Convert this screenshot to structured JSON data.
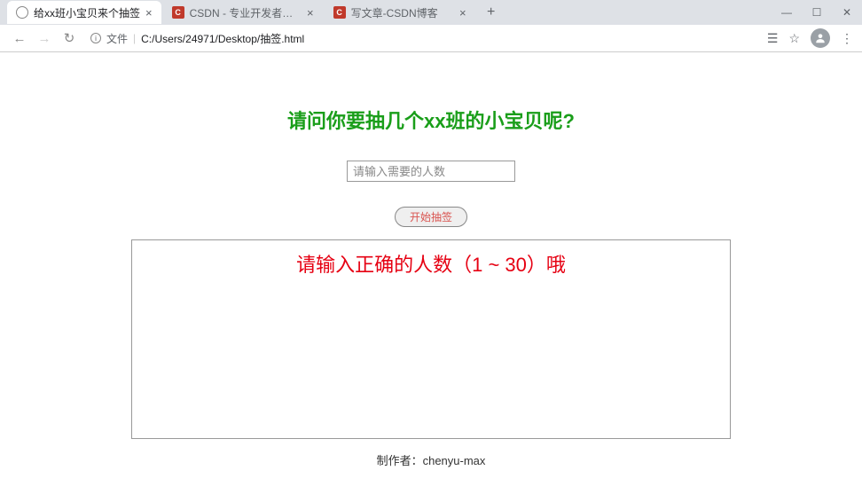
{
  "tabs": [
    {
      "title": "给xx班小宝贝来个抽签",
      "icon": "globe"
    },
    {
      "title": "CSDN - 专业开发者社区",
      "icon": "csdn"
    },
    {
      "title": "写文章-CSDN博客",
      "icon": "csdn"
    }
  ],
  "url": {
    "label": "文件",
    "path": "C:/Users/24971/Desktop/抽签.html"
  },
  "page": {
    "heading": "请问你要抽几个xx班的小宝贝呢?",
    "input_placeholder": "请输入需要的人数",
    "start_button": "开始抽签",
    "error_message": "请输入正确的人数（1 ~ 30）哦",
    "footer": "制作者：chenyu-max"
  },
  "icons": {
    "csdn_letter": "C",
    "close": "×",
    "new_tab": "+",
    "minimize": "—",
    "maximize": "☐",
    "win_close": "✕",
    "back": "←",
    "forward": "→",
    "reload": "↻",
    "info": "i",
    "url_sep": "|",
    "translate": "☰",
    "star": "☆",
    "menu": "⋮"
  }
}
